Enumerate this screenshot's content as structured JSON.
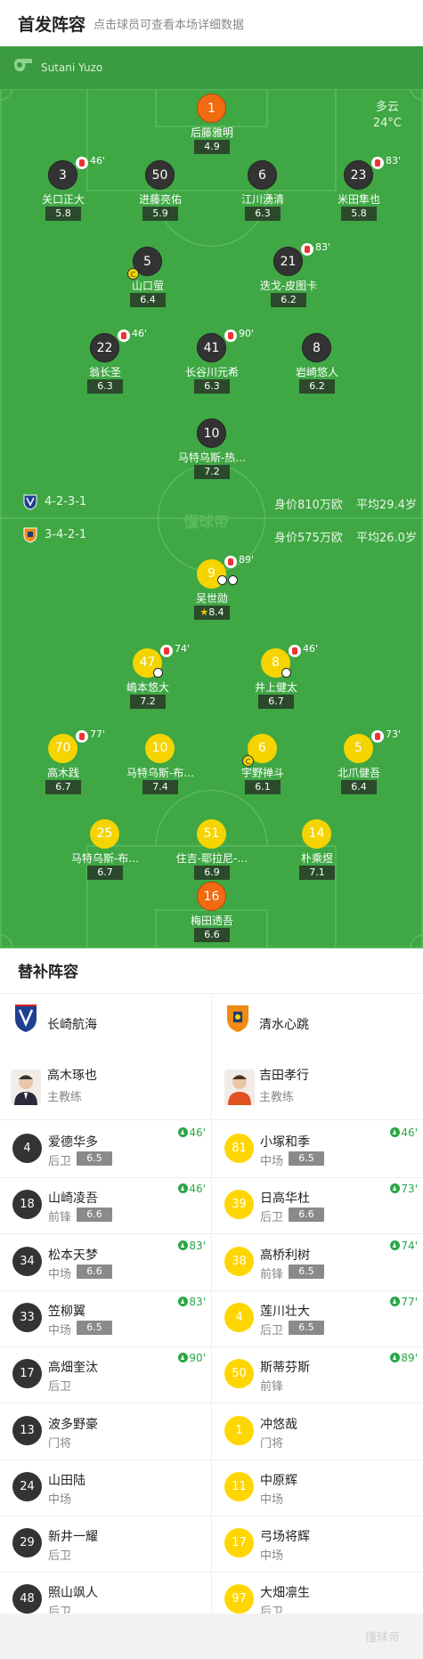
{
  "header": {
    "title": "首发阵容",
    "subtitle": "点击球员可查看本场详细数据"
  },
  "referee": {
    "name": "Sutani Yuzo",
    "icon": "whistle-icon"
  },
  "weather": {
    "condition": "多云",
    "temperature": "24°C"
  },
  "watermark": "懂球帝",
  "teams": {
    "home": {
      "formation": "4-2-3-1",
      "value": "身价810万欧",
      "avg_age": "平均29.4岁"
    },
    "away": {
      "formation": "3-4-2-1",
      "value": "身价575万欧",
      "avg_age": "平均26.0岁"
    }
  },
  "home_players": [
    {
      "num": "1",
      "name": "后藤雅明",
      "rating": "4.9"
    },
    {
      "num": "3",
      "name": "关口正大",
      "rating": "5.8",
      "sub": "46'"
    },
    {
      "num": "50",
      "name": "进藤亮佑",
      "rating": "5.9"
    },
    {
      "num": "6",
      "name": "江川湧清",
      "rating": "6.3"
    },
    {
      "num": "23",
      "name": "米田隼也",
      "rating": "5.8",
      "sub": "83'"
    },
    {
      "num": "5",
      "name": "山口萤",
      "rating": "6.4"
    },
    {
      "num": "21",
      "name": "迭戈-皮图卡",
      "rating": "6.2",
      "sub": "83'"
    },
    {
      "num": "22",
      "name": "翁长圣",
      "rating": "6.3",
      "sub": "46'"
    },
    {
      "num": "41",
      "name": "长谷川元希",
      "rating": "6.3",
      "sub": "90'"
    },
    {
      "num": "8",
      "name": "岩崎悠人",
      "rating": "6.2"
    },
    {
      "num": "10",
      "name": "马特乌斯-热…",
      "rating": "7.2"
    }
  ],
  "away_players": [
    {
      "num": "9",
      "name": "吴世勋",
      "rating": "8.4",
      "sub": "89'"
    },
    {
      "num": "47",
      "name": "嶋本悠大",
      "rating": "7.2",
      "sub": "74'"
    },
    {
      "num": "8",
      "name": "井上健太",
      "rating": "6.7",
      "sub": "46'"
    },
    {
      "num": "70",
      "name": "高木践",
      "rating": "6.7",
      "sub": "77'"
    },
    {
      "num": "10",
      "name": "马特乌斯-布…",
      "rating": "7.4"
    },
    {
      "num": "6",
      "name": "宇野禅斗",
      "rating": "6.1"
    },
    {
      "num": "5",
      "name": "北爪健吾",
      "rating": "6.4",
      "sub": "73'"
    },
    {
      "num": "25",
      "name": "马特乌斯-布…",
      "rating": "6.7"
    },
    {
      "num": "51",
      "name": "住吉-耶拉尼-…",
      "rating": "6.9"
    },
    {
      "num": "14",
      "name": "朴乘煜",
      "rating": "7.1"
    },
    {
      "num": "16",
      "name": "梅田透吾",
      "rating": "6.6"
    }
  ],
  "captain_mark": "C",
  "subs": {
    "title": "替补阵容",
    "home_team": "长崎航海",
    "away_team": "清水心跳",
    "home_coach": {
      "name": "高木琢也",
      "role": "主教练"
    },
    "away_coach": {
      "name": "吉田孝行",
      "role": "主教练"
    },
    "home": [
      {
        "num": "4",
        "name": "爱德华多",
        "pos": "后卫",
        "rating": "6.5",
        "in": "46'"
      },
      {
        "num": "18",
        "name": "山崎凌吾",
        "pos": "前锋",
        "rating": "6.6",
        "in": "46'"
      },
      {
        "num": "34",
        "name": "松本天梦",
        "pos": "中场",
        "rating": "6.6",
        "in": "83'"
      },
      {
        "num": "33",
        "name": "笠柳翼",
        "pos": "中场",
        "rating": "6.5",
        "in": "83'"
      },
      {
        "num": "17",
        "name": "高畑奎汰",
        "pos": "后卫",
        "rating": "",
        "in": "90'"
      },
      {
        "num": "13",
        "name": "波多野豪",
        "pos": "门将",
        "rating": "",
        "in": ""
      },
      {
        "num": "24",
        "name": "山田陆",
        "pos": "中场",
        "rating": "",
        "in": ""
      },
      {
        "num": "29",
        "name": "新井一耀",
        "pos": "后卫",
        "rating": "",
        "in": ""
      },
      {
        "num": "48",
        "name": "照山飒人",
        "pos": "后卫",
        "rating": "",
        "in": ""
      }
    ],
    "away": [
      {
        "num": "81",
        "name": "小塚和季",
        "pos": "中场",
        "rating": "6.5",
        "in": "46'"
      },
      {
        "num": "39",
        "name": "日高华杜",
        "pos": "后卫",
        "rating": "6.6",
        "in": "73'"
      },
      {
        "num": "38",
        "name": "高桥利树",
        "pos": "前锋",
        "rating": "6.5",
        "in": "74'"
      },
      {
        "num": "4",
        "name": "莲川壮大",
        "pos": "后卫",
        "rating": "6.5",
        "in": "77'"
      },
      {
        "num": "50",
        "name": "斯蒂芬斯",
        "pos": "前锋",
        "rating": "",
        "in": "89'"
      },
      {
        "num": "1",
        "name": "冲悠哉",
        "pos": "门将",
        "rating": "",
        "in": ""
      },
      {
        "num": "11",
        "name": "中原辉",
        "pos": "中场",
        "rating": "",
        "in": ""
      },
      {
        "num": "17",
        "name": "弓场将辉",
        "pos": "中场",
        "rating": "",
        "in": ""
      },
      {
        "num": "97",
        "name": "大畑凛生",
        "pos": "后卫",
        "rating": "",
        "in": ""
      }
    ]
  }
}
